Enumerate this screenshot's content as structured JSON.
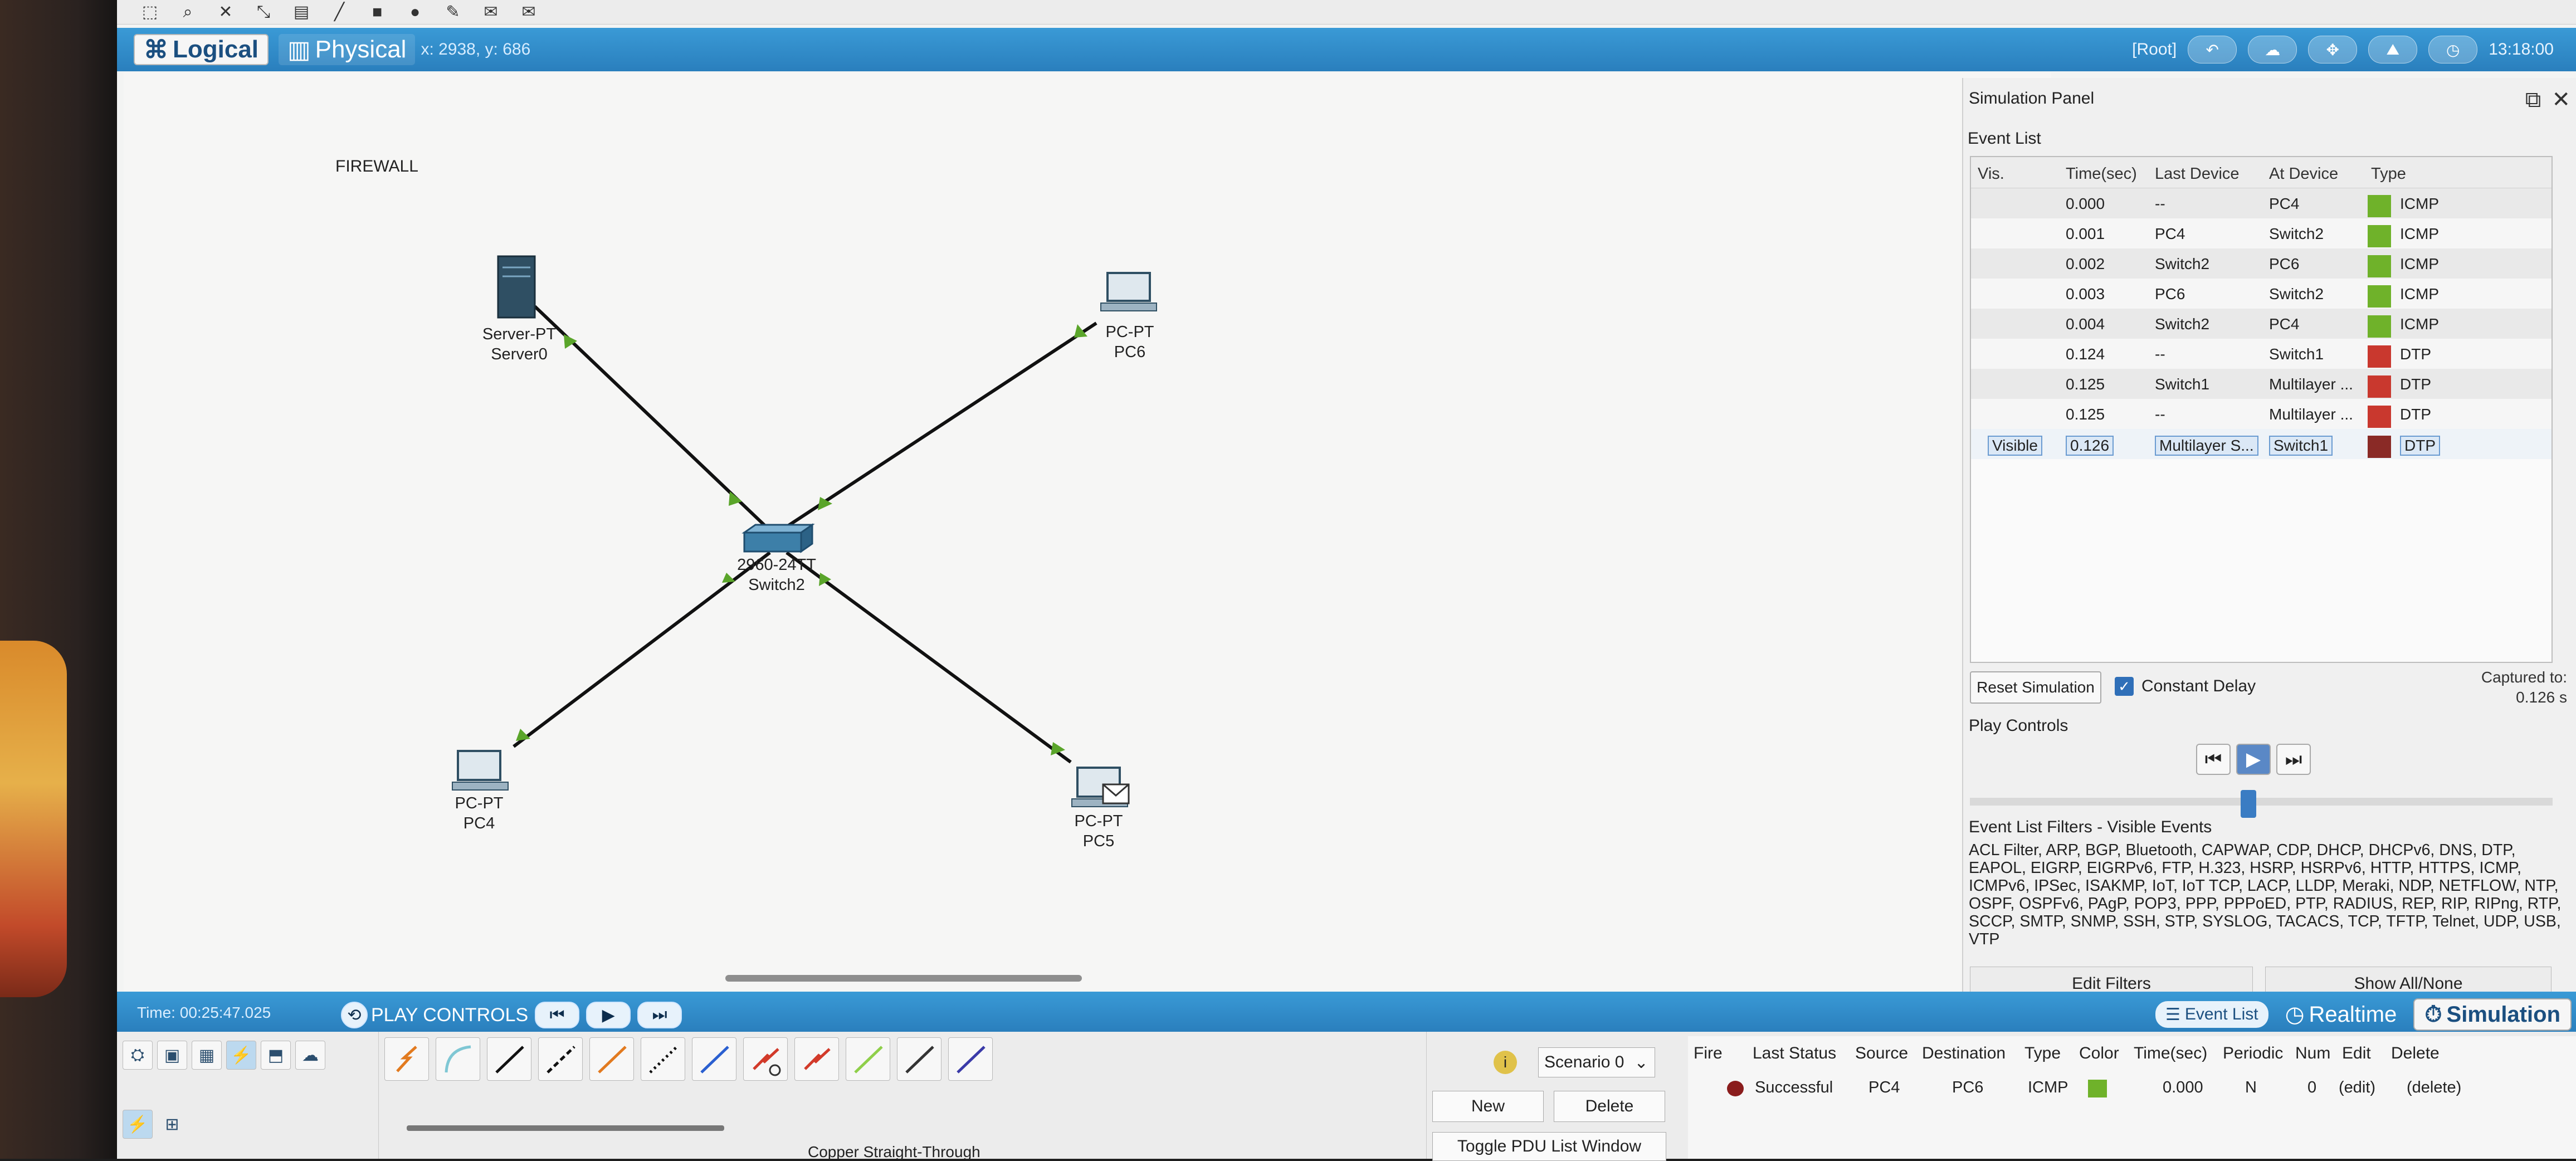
{
  "toolbar": {
    "icons": [
      "select-icon",
      "zoom-icon",
      "delete-icon",
      "resize-icon",
      "note-icon",
      "draw-line-icon",
      "rectangle-icon",
      "ellipse-icon",
      "freeform-icon",
      "simple-pdu-icon",
      "complex-pdu-icon"
    ]
  },
  "modebar": {
    "logical": "Logical",
    "physical": "Physical",
    "coords": "x: 2938, y: 686",
    "root": "[Root]",
    "clock": "13:18:00"
  },
  "workspace": {
    "firewall": "FIREWALL",
    "nodes": [
      {
        "type": "Server-PT",
        "name": "Server0"
      },
      {
        "type": "PC-PT",
        "name": "PC6"
      },
      {
        "type": "2960-24TT",
        "name": "Switch2"
      },
      {
        "type": "PC-PT",
        "name": "PC4"
      },
      {
        "type": "PC-PT",
        "name": "PC5"
      }
    ]
  },
  "sim_panel": {
    "title": "Simulation Panel",
    "event_list_label": "Event List",
    "headers": {
      "vis": "Vis.",
      "time": "Time(sec)",
      "last": "Last Device",
      "at": "At Device",
      "type": "Type"
    },
    "events": [
      {
        "vis": "",
        "time": "0.000",
        "last": "--",
        "at": "PC4",
        "type": "ICMP",
        "color": "#6fb22a"
      },
      {
        "vis": "",
        "time": "0.001",
        "last": "PC4",
        "at": "Switch2",
        "type": "ICMP",
        "color": "#6fb22a"
      },
      {
        "vis": "",
        "time": "0.002",
        "last": "Switch2",
        "at": "PC6",
        "type": "ICMP",
        "color": "#6fb22a"
      },
      {
        "vis": "",
        "time": "0.003",
        "last": "PC6",
        "at": "Switch2",
        "type": "ICMP",
        "color": "#6fb22a"
      },
      {
        "vis": "",
        "time": "0.004",
        "last": "Switch2",
        "at": "PC4",
        "type": "ICMP",
        "color": "#6fb22a"
      },
      {
        "vis": "",
        "time": "0.124",
        "last": "--",
        "at": "Switch1",
        "type": "DTP",
        "color": "#c9382e"
      },
      {
        "vis": "",
        "time": "0.125",
        "last": "Switch1",
        "at": "Multilayer ...",
        "type": "DTP",
        "color": "#c9382e"
      },
      {
        "vis": "",
        "time": "0.125",
        "last": "--",
        "at": "Multilayer ...",
        "type": "DTP",
        "color": "#c9382e"
      },
      {
        "vis": "Visible",
        "time": "0.126",
        "last": "Multilayer S...",
        "at": "Switch1",
        "type": "DTP",
        "color": "#8a2a26"
      }
    ],
    "reset": "Reset Simulation",
    "constant_delay": "Constant Delay",
    "captured_label": "Captured to:",
    "captured_value": "0.126 s",
    "play_controls": "Play Controls",
    "filters_title": "Event List Filters - Visible Events",
    "filters_text": "ACL Filter, ARP, BGP, Bluetooth, CAPWAP, CDP, DHCP, DHCPv6, DNS, DTP, EAPOL, EIGRP, EIGRPv6, FTP, H.323, HSRP, HSRPv6, HTTP, HTTPS, ICMP, ICMPv6, IPSec, ISAKMP, IoT, IoT TCP, LACP, LLDP, Meraki, NDP, NETFLOW, NTP, OSPF, OSPFv6, PAgP, POP3, PPP, PPPoED, PTP, RADIUS, REP, RIP, RIPng, RTP, SCCP, SMTP, SNMP, SSH, STP, SYSLOG, TACACS, TCP, TFTP, Telnet, UDP, USB, VTP",
    "edit_filters": "Edit Filters",
    "show_all": "Show All/None"
  },
  "timebar": {
    "time": "Time: 00:25:47.025",
    "play_controls": "PLAY CONTROLS",
    "event_list": "Event List",
    "realtime": "Realtime",
    "simulation": "Simulation"
  },
  "bottom": {
    "cable_label": "Copper Straight-Through",
    "scenario": "Scenario 0",
    "info": "i",
    "new": "New",
    "delete": "Delete",
    "toggle_pdu": "Toggle PDU List Window",
    "pdu_headers": {
      "fire": "Fire",
      "last_status": "Last Status",
      "source": "Source",
      "destination": "Destination",
      "type": "Type",
      "color": "Color",
      "time": "Time(sec)",
      "periodic": "Periodic",
      "num": "Num",
      "edit": "Edit",
      "delete": "Delete"
    },
    "pdu_row": {
      "last_status": "Successful",
      "source": "PC4",
      "destination": "PC6",
      "type": "ICMP",
      "color": "#6fb22a",
      "time": "0.000",
      "periodic": "N",
      "num": "0",
      "edit": "(edit)",
      "delete": "(delete)"
    }
  }
}
